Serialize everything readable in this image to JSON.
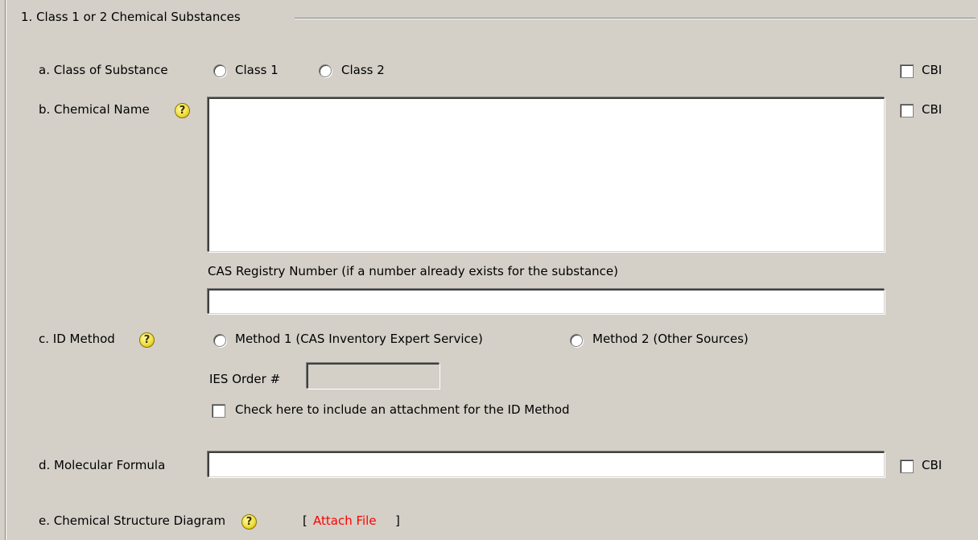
{
  "section": {
    "title": "1.  Class 1 or 2 Chemical Substances"
  },
  "class_of_substance": {
    "label": "a. Class of Substance",
    "options": [
      "Class 1",
      "Class 2"
    ],
    "cbi_label": "CBI"
  },
  "chemical_name": {
    "label": "b. Chemical Name",
    "value": "",
    "cbi_label": "CBI"
  },
  "cas": {
    "label": "CAS Registry Number (if a number already exists for the substance)",
    "value": ""
  },
  "id_method": {
    "label": "c. ID Method",
    "options": [
      "Method 1 (CAS Inventory Expert Service)",
      "Method 2 (Other Sources)"
    ],
    "ies_label": "IES Order #",
    "ies_value": "",
    "attach_checkbox_label": "Check here to include an attachment for the ID Method"
  },
  "molecular_formula": {
    "label": "d. Molecular Formula",
    "value": "",
    "cbi_label": "CBI"
  },
  "structure_diagram": {
    "label": "e. Chemical Structure Diagram",
    "bracket_open": "[",
    "attach_label": "Attach File",
    "bracket_close": "]"
  },
  "help_icon_glyph": "?",
  "colors": {
    "background": "#d4d0c8",
    "link": "#ff0000",
    "help": "#f0e040"
  }
}
